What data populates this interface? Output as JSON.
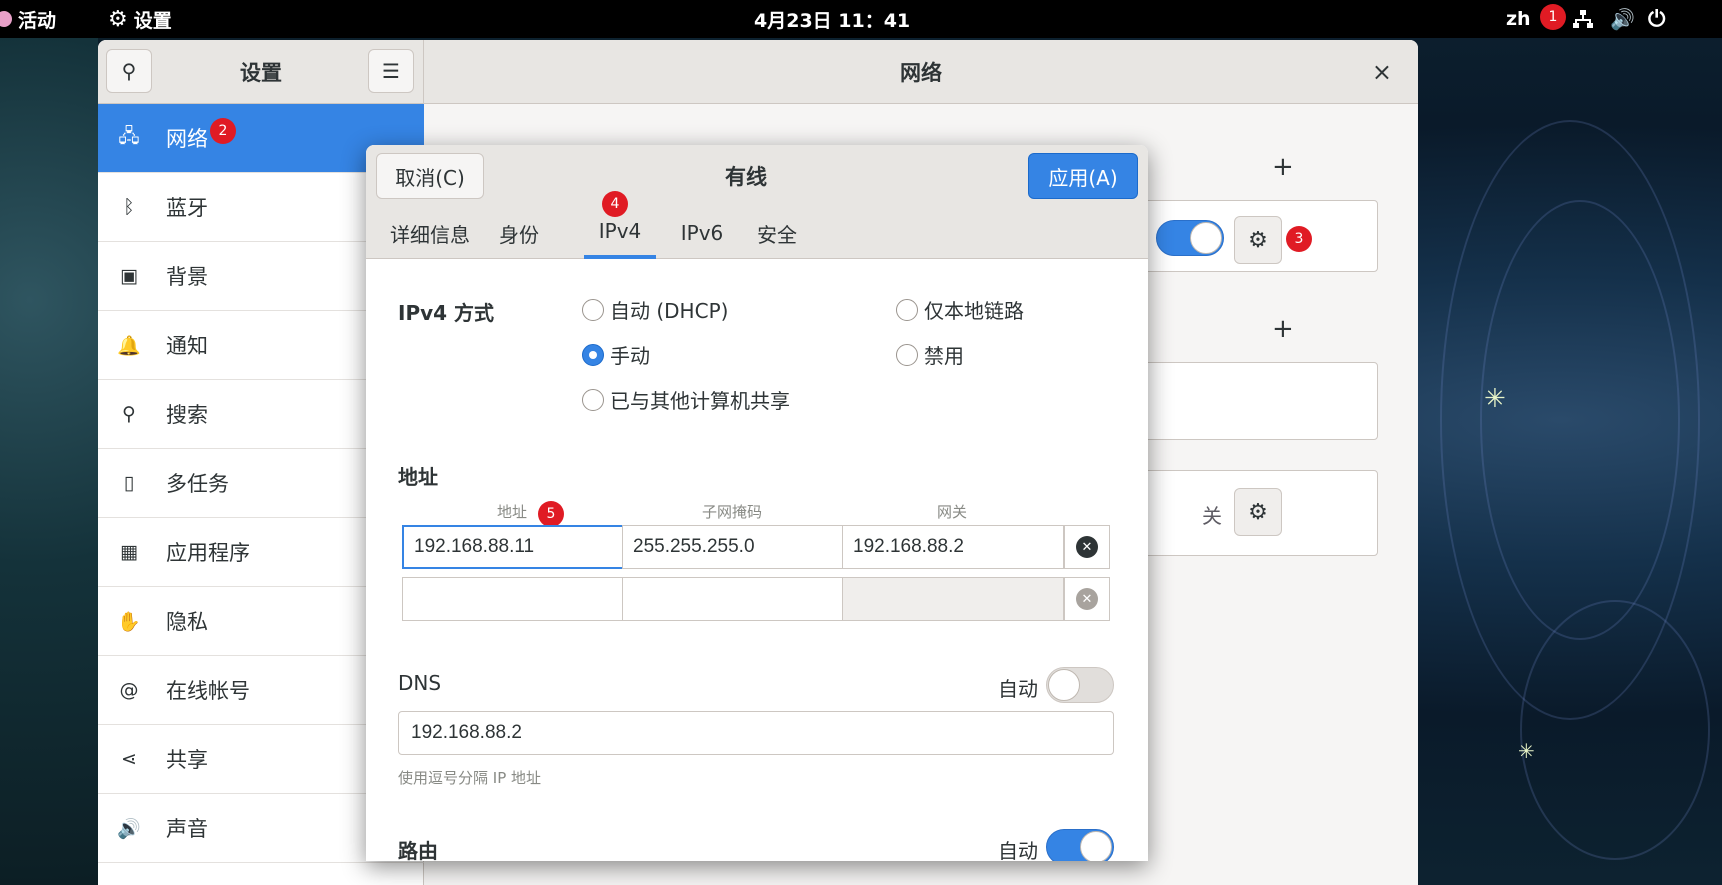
{
  "topbar": {
    "activities": "活动",
    "settings_menu": "设置",
    "clock": "4月23日  11：41",
    "input_method": "zh",
    "badge1": "1"
  },
  "window": {
    "sidebar_title": "设置",
    "main_title": "网络",
    "close": "×"
  },
  "sidebar": {
    "items": [
      {
        "label": "网络",
        "icon": "network-icon",
        "glyph": "🖧"
      },
      {
        "label": "蓝牙",
        "icon": "bluetooth-icon",
        "glyph": "ᛒ"
      },
      {
        "label": "背景",
        "icon": "background-icon",
        "glyph": "▣"
      },
      {
        "label": "通知",
        "icon": "bell-icon",
        "glyph": "🔔"
      },
      {
        "label": "搜索",
        "icon": "search-icon",
        "glyph": "⚲"
      },
      {
        "label": "多任务",
        "icon": "multitask-icon",
        "glyph": "▯"
      },
      {
        "label": "应用程序",
        "icon": "apps-icon",
        "glyph": "▦"
      },
      {
        "label": "隐私",
        "icon": "hand-icon",
        "glyph": "✋"
      },
      {
        "label": "在线帐号",
        "icon": "at-icon",
        "glyph": "@"
      },
      {
        "label": "共享",
        "icon": "share-icon",
        "glyph": "⋖"
      },
      {
        "label": "声音",
        "icon": "speaker-icon",
        "glyph": "🔊"
      }
    ],
    "badge2": "2"
  },
  "content": {
    "off_label": "关",
    "badge3": "3"
  },
  "dialog": {
    "cancel": "取消(C)",
    "title": "有线",
    "apply": "应用(A)",
    "tabs": [
      "详细信息",
      "身份",
      "IPv4",
      "IPv6",
      "安全"
    ],
    "badge4": "4",
    "ipv4_method_label": "IPv4 方式",
    "methods": {
      "auto_dhcp": "自动 (DHCP)",
      "link_local": "仅本地链路",
      "manual": "手动",
      "disable": "禁用",
      "shared": "已与其他计算机共享"
    },
    "address_section": "地址",
    "columns": [
      "地址",
      "子网掩码",
      "网关"
    ],
    "badge5": "5",
    "rows": [
      {
        "address": "192.168.88.11",
        "netmask": "255.255.255.0",
        "gateway": "192.168.88.2"
      },
      {
        "address": "",
        "netmask": "",
        "gateway": ""
      }
    ],
    "dns_label": "DNS",
    "dns_auto_label": "自动",
    "dns_value": "192.168.88.2",
    "dns_hint": "使用逗号分隔 IP 地址",
    "routes_label": "路由",
    "routes_auto_label": "自动"
  },
  "colors": {
    "accent": "#3584e4",
    "badge": "#e01b24"
  }
}
